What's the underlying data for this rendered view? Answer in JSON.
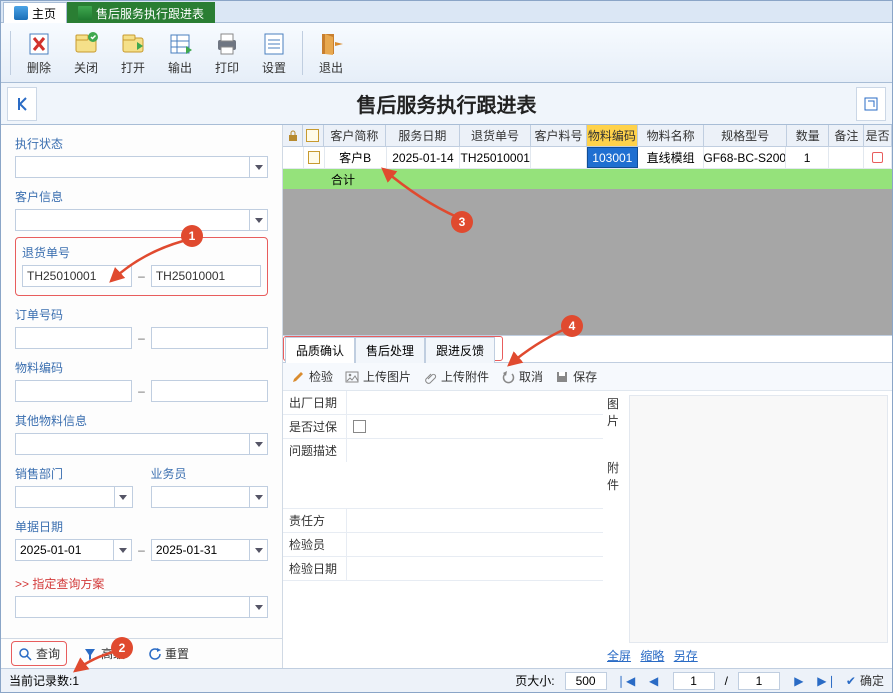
{
  "tabs": {
    "home": "主页",
    "sheet": "售后服务执行跟进表"
  },
  "toolbar": {
    "delete": "删除",
    "close": "关闭",
    "open": "打开",
    "export": "输出",
    "print": "打印",
    "settings": "设置",
    "exit": "退出"
  },
  "title": "售后服务执行跟进表",
  "filters": {
    "exec_status_label": "执行状态",
    "customer_info_label": "客户信息",
    "return_no_label": "退货单号",
    "return_no_from": "TH25010001",
    "return_no_to": "TH25010001",
    "order_no_label": "订单号码",
    "material_code_label": "物料编码",
    "other_material_label": "其他物料信息",
    "sales_dept_label": "销售部门",
    "salesman_label": "业务员",
    "bill_date_label": "单据日期",
    "bill_date_from": "2025-01-01",
    "bill_date_to": "2025-01-31",
    "scheme_label": ">>  指定查询方案"
  },
  "sidebar_buttons": {
    "query": "查询",
    "advanced": "高级",
    "reset": "重置"
  },
  "grid": {
    "cols": [
      "客户简称",
      "服务日期",
      "退货单号",
      "客户料号",
      "物料编码",
      "物料名称",
      "规格型号",
      "数量",
      "备注",
      "是否"
    ],
    "row": {
      "customer": "客户B",
      "service_date": "2025-01-14",
      "return_no": "TH25010001",
      "cust_part": "",
      "material_code": "103001",
      "material_name": "直线模组",
      "spec": "GF68-BC-S200",
      "qty": "1",
      "remark": ""
    },
    "total_label": "合计"
  },
  "sub_tabs": {
    "t1": "品质确认",
    "t2": "售后处理",
    "t3": "跟进反馈"
  },
  "detail_toolbar": {
    "inspect": "检验",
    "upload_img": "上传图片",
    "upload_att": "上传附件",
    "cancel": "取消",
    "save": "保存"
  },
  "detail_form": {
    "ship_date": "出厂日期",
    "over_warranty": "是否过保",
    "problem_desc": "问题描述",
    "responsible": "责任方",
    "inspector": "检验员",
    "inspect_date": "检验日期"
  },
  "detail_side": {
    "image_label": "图片",
    "attach_label": "附件",
    "fullscreen": "全屏",
    "thumb": "缩略",
    "saveas": "另存"
  },
  "status": {
    "record_count": "当前记录数:1",
    "page_size_label": "页大小:",
    "page_size": "500",
    "page_cur": "1",
    "page_total": "1",
    "confirm": "确定"
  },
  "badges": {
    "b1": "1",
    "b2": "2",
    "b3": "3",
    "b4": "4"
  }
}
